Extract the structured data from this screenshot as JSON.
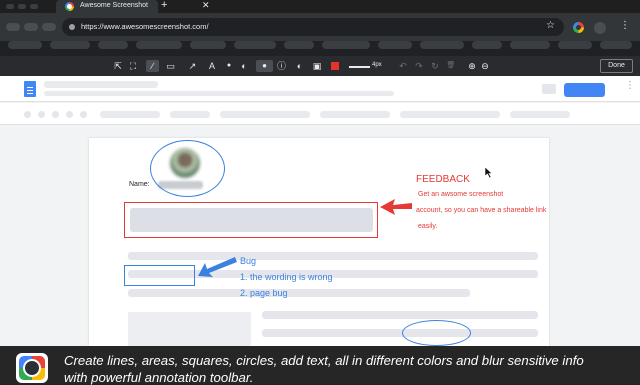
{
  "browser": {
    "tab_title": "Awesome Screenshot",
    "tab_close": "✕",
    "new_tab": "+",
    "url": "https://www.awesomescreenshot.com/",
    "star_icon": "☆",
    "menu_icon": "⋮"
  },
  "toolbar": {
    "crop_icon": "⇱",
    "resize_icon": "⛶",
    "pen_icon": "∕",
    "rect_icon": "▭",
    "arrow_icon": "↗",
    "text_icon": "A",
    "blur_icon": "●",
    "fill_icon": "◐",
    "comment_icon": "●",
    "info_icon": "ⓘ",
    "shape_icon": "◐",
    "image_icon": "▣",
    "stroke_width": "4px",
    "undo_icon": "↶",
    "redo_icon": "↷",
    "reset_icon": "↻",
    "delete_icon": "🗑",
    "zoom_in_icon": "⊕",
    "zoom_out_icon": "⊖",
    "done_label": "Done",
    "active_color": "#e6312a"
  },
  "doc": {
    "name_label": "Name:",
    "menu_icon": "⋮"
  },
  "annotations": {
    "feedback_title": "FEEDBACK",
    "feedback_lines": [
      "Get an awsome screenshot",
      "account, so you can have a shareable link",
      "easily."
    ],
    "bug_title": "Bug",
    "bug_lines": [
      "1. the wording is wrong",
      "2. page bug"
    ],
    "red_color": "#e53935",
    "blue_color": "#3b82e0"
  },
  "caption": {
    "line1": "Create lines, areas, squares, circles, add text, all in different colors and blur sensitive info",
    "line2": "with powerful annotation toolbar."
  }
}
